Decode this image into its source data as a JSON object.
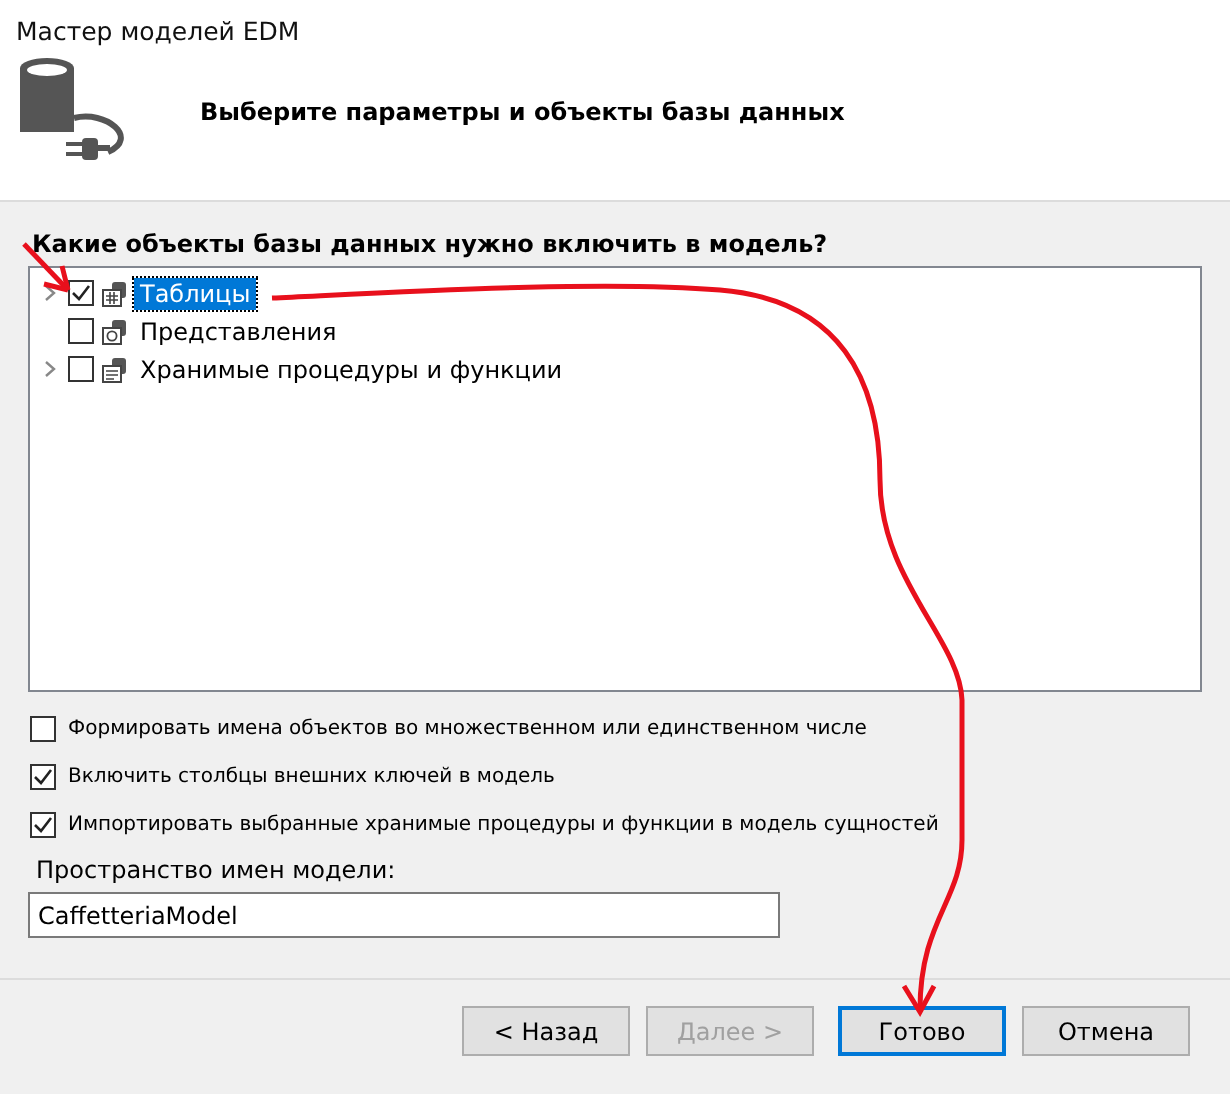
{
  "window": {
    "title": "Мастер моделей EDM"
  },
  "header": {
    "title": "Выберите параметры и объекты базы данных"
  },
  "question": "Какие объекты базы данных нужно включить в модель?",
  "tree": [
    {
      "label": "Таблицы",
      "checked": true,
      "selected": true,
      "expandable": true,
      "kind": "tables"
    },
    {
      "label": "Представления",
      "checked": false,
      "selected": false,
      "expandable": false,
      "kind": "views"
    },
    {
      "label": "Хранимые процедуры и функции",
      "checked": false,
      "selected": false,
      "expandable": true,
      "kind": "procedures"
    }
  ],
  "options": [
    {
      "label": "Формировать имена объектов во множественном или единственном числе",
      "checked": false
    },
    {
      "label": "Включить столбцы внешних ключей в модель",
      "checked": true
    },
    {
      "label": "Импортировать выбранные хранимые процедуры и функции в модель сущностей",
      "checked": true
    }
  ],
  "namespace": {
    "label": "Пространство имен модели:",
    "value": "CaffetteriaModel"
  },
  "buttons": [
    {
      "label": "< Назад",
      "disabled": false,
      "focused": false
    },
    {
      "label": "Далее >",
      "disabled": true,
      "focused": false
    },
    {
      "label": "Готово",
      "disabled": false,
      "focused": true
    },
    {
      "label": "Отмена",
      "disabled": false,
      "focused": false
    }
  ]
}
